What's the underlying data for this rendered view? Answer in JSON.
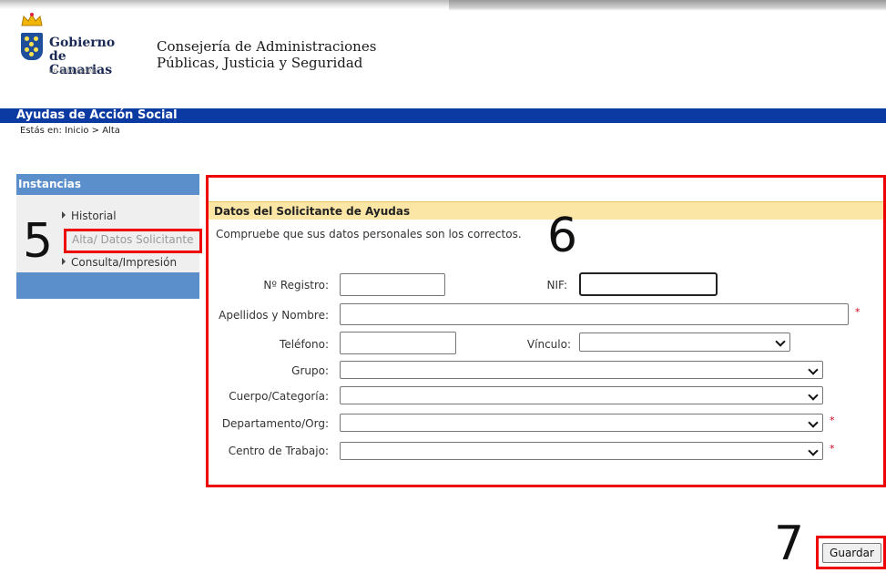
{
  "header": {
    "logo_name_line1": "Gobierno",
    "logo_name_line2": "de Canarias",
    "logo_tagline": "un solo pueblo",
    "department_line1": "Consejería de Administraciones",
    "department_line2": "Públicas, Justicia y Seguridad"
  },
  "app": {
    "title": "Ayudas de Acción Social",
    "breadcrumb": "Estás en: Inicio > Alta"
  },
  "sidebar": {
    "title": "Instancias",
    "items": [
      {
        "label": "Historial"
      },
      {
        "label": "Alta/ Datos Solicitante"
      },
      {
        "label": "Consulta/Impresión"
      }
    ]
  },
  "form": {
    "title": "Datos del Solicitante de Ayudas",
    "intro": "Compruebe que sus datos personales son los correctos.",
    "fields": {
      "registro": {
        "label": "Nº Registro:",
        "value": ""
      },
      "nif": {
        "label": "NIF:",
        "value": ""
      },
      "nombre": {
        "label": "Apellidos y Nombre:",
        "value": "",
        "required": "*"
      },
      "telefono": {
        "label": "Teléfono:",
        "value": ""
      },
      "vinculo": {
        "label": "Vínculo:",
        "value": ""
      },
      "grupo": {
        "label": "Grupo:",
        "value": ""
      },
      "cuerpo": {
        "label": "Cuerpo/Categoría:",
        "value": ""
      },
      "departamento": {
        "label": "Departamento/Org:",
        "value": "",
        "required": "*"
      },
      "centro": {
        "label": "Centro de Trabajo:",
        "value": "",
        "required": "*"
      }
    },
    "save_label": "Guardar"
  },
  "annotations": {
    "step5": "5",
    "step6": "6",
    "step7": "7",
    "highlight_color": "#ee0000"
  }
}
